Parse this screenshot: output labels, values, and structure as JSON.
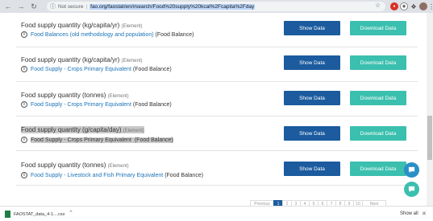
{
  "browser": {
    "security_label": "Not secure",
    "separator": "|",
    "url": "fao.org/faostat/en/#search/Food%20supply%20kcal%2Fcapita%2Fday",
    "colors": {
      "ext_red": "#d93025",
      "ext_dark": "#444444",
      "avatar": "#8d6e63"
    }
  },
  "rows": [
    {
      "title": "Food supply quantity (kg/capita/yr)",
      "element": "(Element)",
      "link": "Food Balances (old methodology and population)",
      "domain": "(Food Balance)",
      "show": "Show Data",
      "download": "Download Data"
    },
    {
      "title": "Food supply quantity (kg/capita/yr)",
      "element": "(Element)",
      "link": "Food Supply - Crops Primary Equivalent",
      "domain": "(Food Balance)",
      "show": "Show Data",
      "download": "Download Data"
    },
    {
      "title": "Food supply quantity (tonnes)",
      "element": "(Element)",
      "link": "Food Supply - Crops Primary Equivalent",
      "domain": "(Food Balance)",
      "show": "Show Data",
      "download": "Download Data"
    },
    {
      "title": "Food supply quantity (g/capita/day)",
      "element": "(Element)",
      "link": "Food Supply - Crops Primary Equivalent",
      "domain": "(Food Balance)",
      "show": "Show Data",
      "download": "Download Data"
    },
    {
      "title": "Food supply quantity (tonnes)",
      "element": "(Element)",
      "link": "Food Supply - Livestock and Fish Primary Equivalent",
      "domain": "(Food Balance)",
      "show": "Show Data",
      "download": "Download Data"
    }
  ],
  "pagination": [
    "Previous",
    "1",
    "2",
    "3",
    "4",
    "5",
    "6",
    "7",
    "8",
    "9",
    "10",
    "Next"
  ],
  "downloads": {
    "file": "FAOSTAT_data_4-1....csv",
    "show_all": "Show all"
  }
}
